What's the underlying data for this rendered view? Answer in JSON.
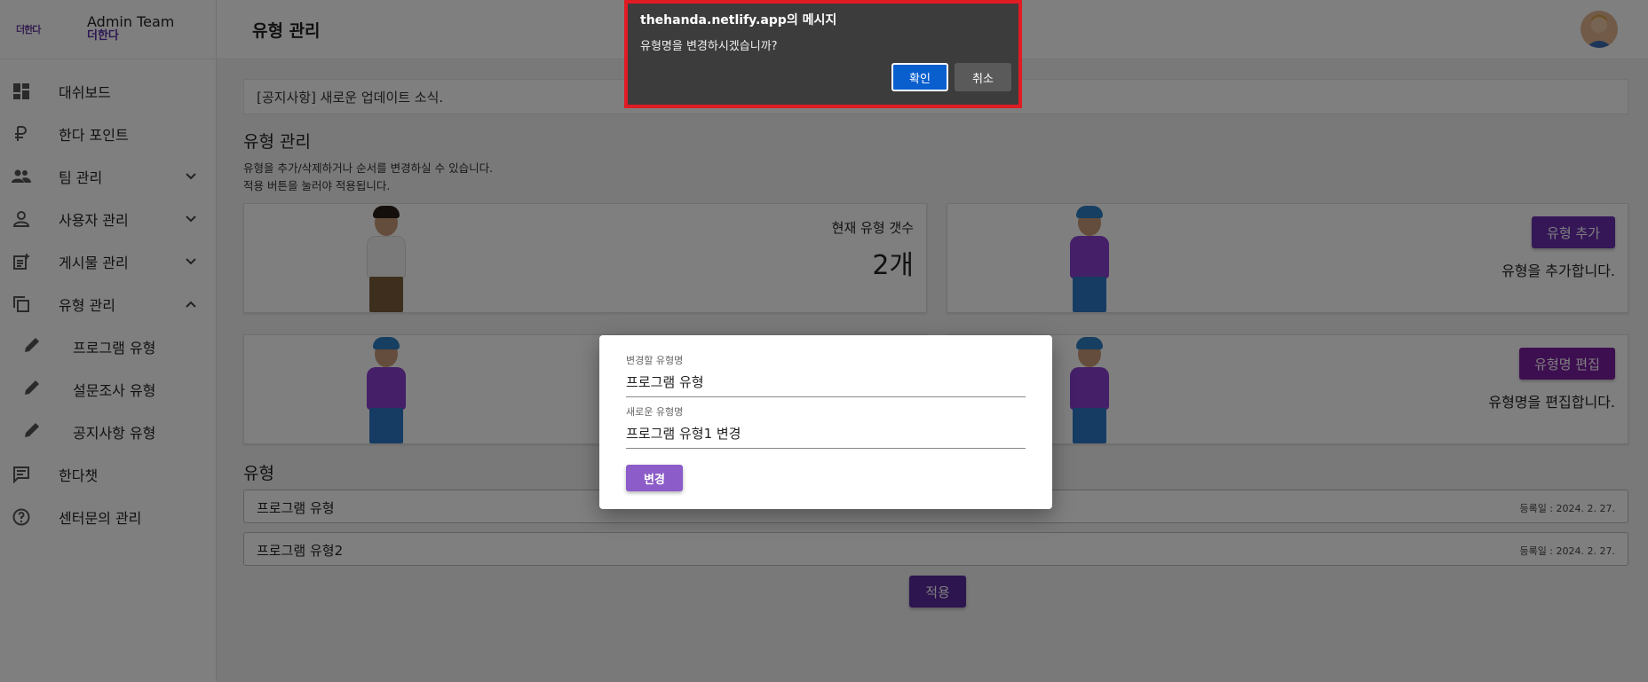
{
  "brand": {
    "logo_text": "더한다",
    "title": "Admin Team",
    "subtitle": "더한다"
  },
  "sidebar": {
    "items": [
      {
        "label": "대쉬보드"
      },
      {
        "label": "한다 포인트"
      },
      {
        "label": "팀 관리"
      },
      {
        "label": "사용자 관리"
      },
      {
        "label": "게시물 관리"
      },
      {
        "label": "유형 관리"
      },
      {
        "label": "프로그램 유형"
      },
      {
        "label": "설문조사 유형"
      },
      {
        "label": "공지사항 유형"
      },
      {
        "label": "한다챗"
      },
      {
        "label": "센터문의 관리"
      }
    ]
  },
  "header": {
    "title": "유형 관리"
  },
  "notice": {
    "text": "[공지사항] 새로운 업데이트 소식."
  },
  "main": {
    "section_title": "유형 관리",
    "desc_line1": "유형을 추가/삭제하거나 순서를 변경하실 수 있습니다.",
    "desc_line2": "적용 버튼을 눌러야 적용됩니다.",
    "count_card": {
      "label": "현재 유형 갯수",
      "value": "2개"
    },
    "add_card": {
      "button": "유형 추가",
      "desc": "유형을 추가합니다."
    },
    "edit_card": {
      "button": "유형명 편집",
      "desc": "유형명을 편집합니다."
    },
    "list_title": "유형",
    "types": [
      {
        "name": "프로그램 유형",
        "date": "등록일 : 2024. 2. 27."
      },
      {
        "name": "프로그램 유형2",
        "date": "등록일 : 2024. 2. 27."
      }
    ],
    "apply_button": "적용"
  },
  "modal": {
    "field1_label": "변경할 유형명",
    "field1_value": "프로그램 유형",
    "field2_label": "새로운 유형명",
    "field2_value": "프로그램 유형1 변경",
    "button": "변경"
  },
  "dialog": {
    "title": "thehanda.netlify.app의 메시지",
    "message": "유형명을 변경하시겠습니까?",
    "ok": "확인",
    "cancel": "취소"
  },
  "colors": {
    "accent": "#6a2fb0",
    "dialog_border": "#e01b24",
    "dialog_ok": "#0a5fcf"
  }
}
